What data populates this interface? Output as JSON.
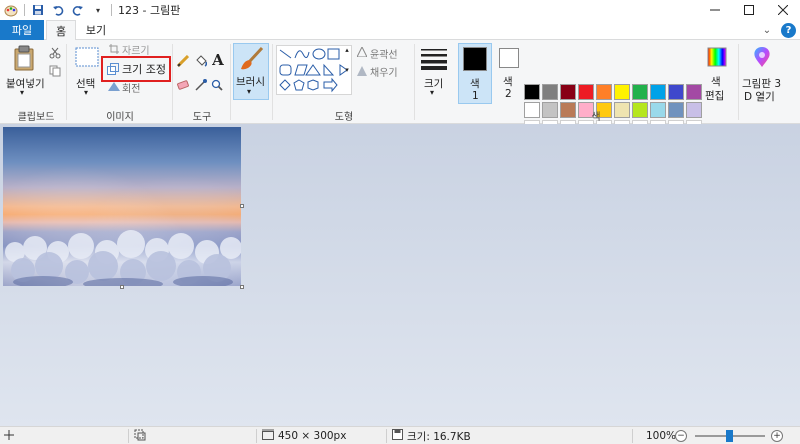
{
  "window": {
    "title": "123 - 그림판",
    "minimize_icon": "minimize-icon",
    "maximize_icon": "maximize-icon",
    "close_icon": "close-icon"
  },
  "quick_access": [
    "paint-app-icon",
    "save-icon",
    "undo-icon",
    "redo-icon",
    "customize-dropdown-icon"
  ],
  "tabs": {
    "file": "파일",
    "home": "홈",
    "view": "보기",
    "help": "?"
  },
  "ribbon": {
    "clipboard": {
      "paste": "붙여넣기",
      "group": "클립보드",
      "cut_icon": "scissors-icon",
      "copy_icon": "copy-icon"
    },
    "image": {
      "select": "선택",
      "crop": "자르기",
      "resize": "크기 조정",
      "rotate": "회전",
      "group": "이미지"
    },
    "tools": {
      "group": "도구",
      "pencil_icon": "pencil-icon",
      "fill_icon": "fill-bucket-icon",
      "text_icon": "text-icon",
      "eraser_icon": "eraser-icon",
      "picker_icon": "color-picker-icon",
      "magnifier_icon": "magnifier-icon"
    },
    "brushes": {
      "label": "브러시"
    },
    "shapes": {
      "outline": "윤곽선",
      "fill": "채우기",
      "group": "도형"
    },
    "size": {
      "label": "크기"
    },
    "colors": {
      "color1": "색",
      "color1_num": "1",
      "color2": "색",
      "color2_num": "2",
      "color1_value": "#000000",
      "color2_value": "#ffffff",
      "edit": "색",
      "edit2": "편집",
      "group": "색",
      "palette": [
        "#000000",
        "#7f7f7f",
        "#880015",
        "#ed1c24",
        "#ff7f27",
        "#fff200",
        "#22b14c",
        "#00a2e8",
        "#3f48cc",
        "#a349a4",
        "#ffffff",
        "#c3c3c3",
        "#b97a57",
        "#ffaec9",
        "#ffc90e",
        "#efe4b0",
        "#b5e61d",
        "#99d9ea",
        "#7092be",
        "#c8bfe7",
        "#ffffff",
        "#ffffff",
        "#ffffff",
        "#ffffff",
        "#ffffff",
        "#ffffff",
        "#ffffff",
        "#ffffff",
        "#ffffff",
        "#ffffff"
      ]
    },
    "paint3d": {
      "label1": "그림판 3",
      "label2": "D 열기"
    }
  },
  "status": {
    "cursor_icon": "cursor-position-icon",
    "selection_icon": "selection-size-icon",
    "dimensions": "450 × 300px",
    "file_size": "크기: 16.7KB",
    "zoom": "100%"
  },
  "highlight_color": "#e02020"
}
